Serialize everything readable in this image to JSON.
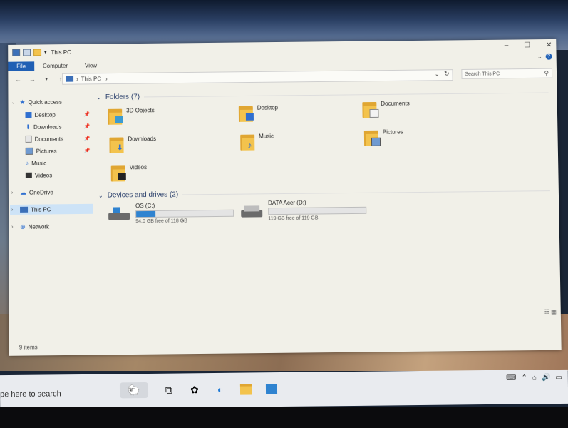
{
  "window": {
    "title": "This PC",
    "controls": {
      "minimize": "–",
      "maximize": "☐",
      "close": "✕"
    }
  },
  "ribbon": {
    "tabs": [
      "File",
      "Computer",
      "View"
    ]
  },
  "nav": {
    "back": "←",
    "forward": "→",
    "recent": "▾",
    "up": "↑",
    "breadcrumb": "This PC",
    "breadcrumb_sep": "›",
    "search_placeholder": "Search This PC"
  },
  "sidebar": {
    "quick_access": "Quick access",
    "items": [
      {
        "label": "Desktop",
        "pinned": true
      },
      {
        "label": "Downloads",
        "pinned": true
      },
      {
        "label": "Documents",
        "pinned": true
      },
      {
        "label": "Pictures",
        "pinned": true
      },
      {
        "label": "Music",
        "pinned": false
      },
      {
        "label": "Videos",
        "pinned": false
      }
    ],
    "onedrive": "OneDrive",
    "this_pc": "This PC",
    "network": "Network"
  },
  "folders": {
    "header": "Folders (7)",
    "items": [
      "3D Objects",
      "Desktop",
      "Documents",
      "Downloads",
      "Music",
      "Pictures",
      "Videos"
    ]
  },
  "drives": {
    "header": "Devices and drives (2)",
    "items": [
      {
        "name": "OS (C:)",
        "free": "94.0 GB free of 118 GB",
        "used_fraction": 0.2
      },
      {
        "name": "DATA Acer (D:)",
        "free": "119 GB free of 119 GB",
        "used_fraction": 0.0
      }
    ]
  },
  "status": {
    "items": "9 items"
  },
  "taskbar": {
    "search": "pe here to search"
  },
  "colors": {
    "accent": "#1f5fb4",
    "folder": "#f3c34d",
    "bar": "#2f83d0"
  }
}
